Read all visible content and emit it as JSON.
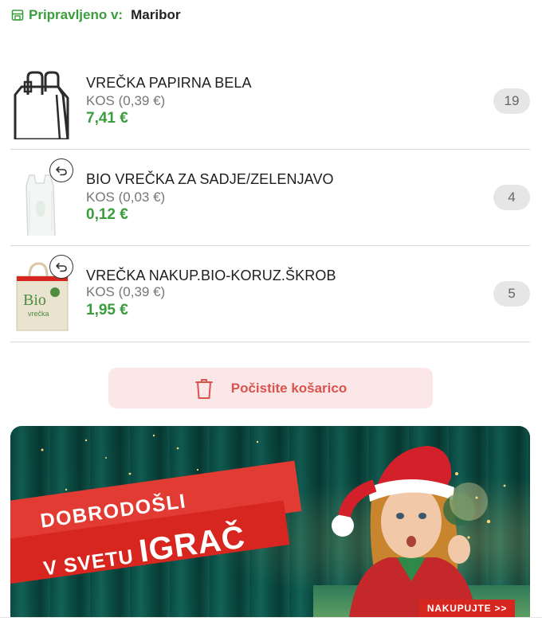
{
  "pickup": {
    "label": "Pripravljeno v:",
    "city": "Maribor"
  },
  "items": [
    {
      "name": "VREČKA PAPIRNA BELA",
      "unit": "KOS (0,39 €)",
      "price": "7,41 €",
      "quantity": "19",
      "icon": "paper-bag-icon"
    },
    {
      "name": "BIO VREČKA ZA SADJE/ZELENJAVO",
      "unit": "KOS (0,03 €)",
      "price": "0,12 €",
      "quantity": "4",
      "icon": "produce-bag-image"
    },
    {
      "name": "VREČKA NAKUP.BIO-KORUZ.ŠKROB",
      "unit": "KOS (0,39 €)",
      "price": "1,95 €",
      "quantity": "5",
      "icon": "bio-bag-image",
      "bag_text_1": "Bio",
      "bag_text_2": "vrečka"
    }
  ],
  "clear_cart": {
    "label": "Počistite košarico",
    "icon": "trash-icon"
  },
  "banner": {
    "line1": "DOBRODOŠLI",
    "line2_small": "V SVETU ",
    "line2_big": "IGRAČ",
    "cta": "NAKUPUJTE >>"
  },
  "colors": {
    "green": "#3a9d3c",
    "red": "#d7261f",
    "clear_bg": "#fbe7e7",
    "badge_bg": "#e6e6e6"
  }
}
